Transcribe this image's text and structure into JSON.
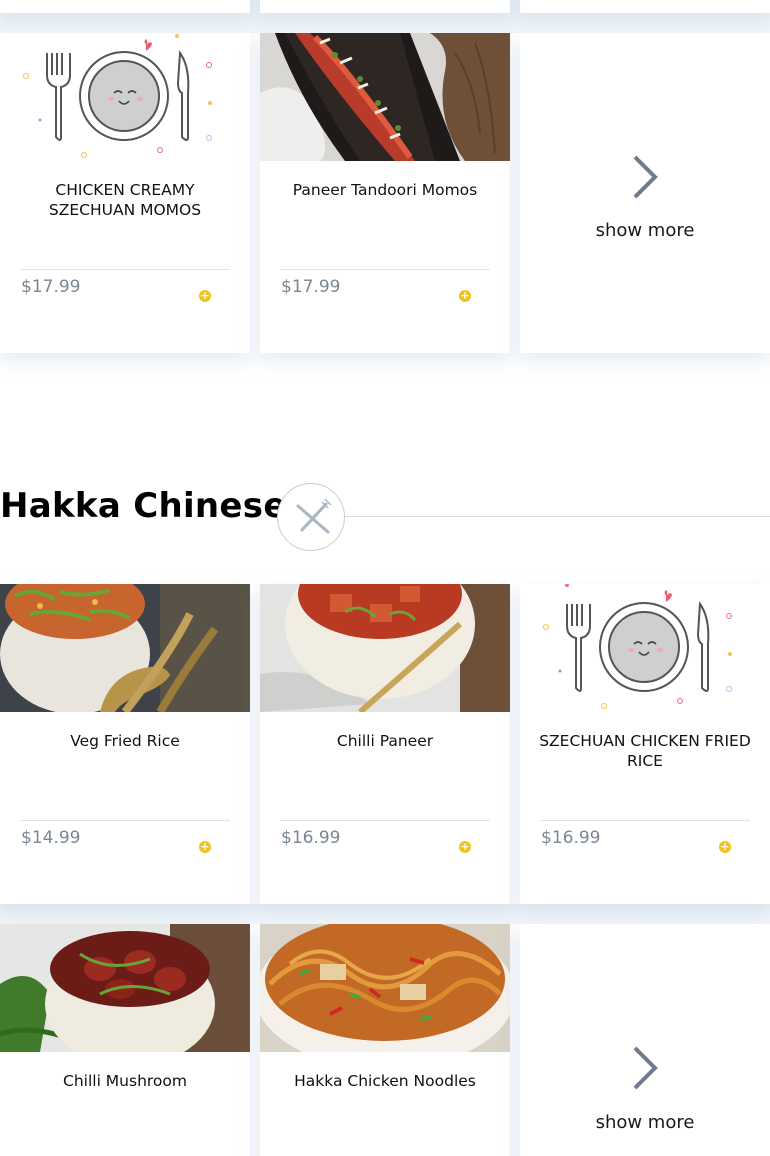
{
  "top_cards": [
    {
      "title": "CHICKEN CREAMY SZECHUAN MOMOS",
      "price": "$17.99"
    },
    {
      "title": "Paneer Tandoori Momos",
      "price": "$17.99"
    }
  ],
  "top_more": {
    "label": "show more"
  },
  "section": {
    "title": "Hakka Chinese"
  },
  "section_cards": [
    {
      "title": "Veg Fried Rice",
      "price": "$14.99"
    },
    {
      "title": "Chilli Paneer",
      "price": "$16.99"
    },
    {
      "title": "SZECHUAN CHICKEN FRIED RICE",
      "price": "$16.99"
    },
    {
      "title": "Chilli Mushroom"
    },
    {
      "title": "Hakka Chicken Noodles"
    }
  ],
  "section_more": {
    "label": "show more"
  },
  "icons": {
    "add": "plus-circle-icon",
    "more": "chevron-right-icon",
    "section": "fork-knife-icon"
  },
  "colors": {
    "add_button": "#eec21f",
    "price": "#7b8595",
    "chevron": "#6d7b8c",
    "shadow": "#e9f0f7"
  }
}
